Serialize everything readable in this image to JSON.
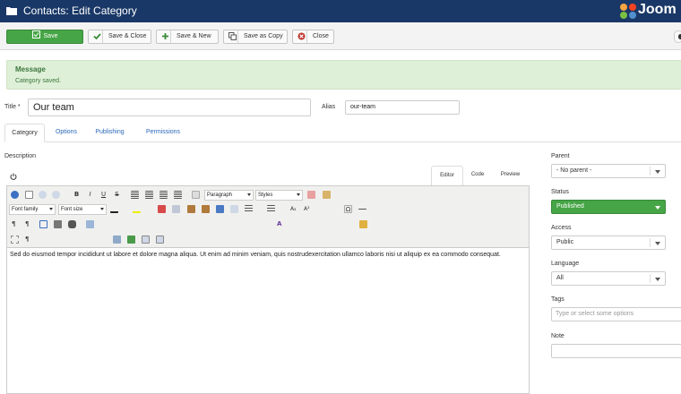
{
  "header": {
    "title": "Contacts: Edit Category",
    "logo_text": "Joom"
  },
  "toolbar": {
    "save": "Save",
    "save_close": "Save & Close",
    "save_new": "Save & New",
    "save_copy": "Save as Copy",
    "close": "Close"
  },
  "message": {
    "heading": "Message",
    "text": "Category saved."
  },
  "form": {
    "title_label": "Title *",
    "title_value": "Our team",
    "alias_label": "Alias",
    "alias_value": "our-team"
  },
  "tabs": [
    "Category",
    "Options",
    "Publishing",
    "Permissions"
  ],
  "description_label": "Description",
  "editor": {
    "tabs": [
      "Editor",
      "Code",
      "Preview"
    ],
    "format_select": "Paragraph",
    "styles_select": "Styles",
    "font_family": "Font family",
    "font_size": "Font size",
    "content": "Sed do eiusmod tempor incididunt ut labore et dolore magna aliqua. Ut enim ad minim veniam, quis nostrudexercitation ullamco laboris nisi ut aliquip ex ea commodo consequat."
  },
  "sidebar": {
    "parent_label": "Parent",
    "parent_value": "- No parent -",
    "status_label": "Status",
    "status_value": "Published",
    "access_label": "Access",
    "access_value": "Public",
    "language_label": "Language",
    "language_value": "All",
    "tags_label": "Tags",
    "tags_placeholder": "Type or select some options",
    "note_label": "Note",
    "note_value": ""
  },
  "colors": {
    "header_bg": "#1a3867",
    "save_green": "#46a546",
    "link_blue": "#2a69b8",
    "message_bg": "#dff0d8"
  },
  "icons": [
    "folder-icon",
    "joomla-logo",
    "check-icon",
    "plus-icon",
    "copy-icon",
    "close-icon",
    "power-icon",
    "chevron-down-icon"
  ]
}
